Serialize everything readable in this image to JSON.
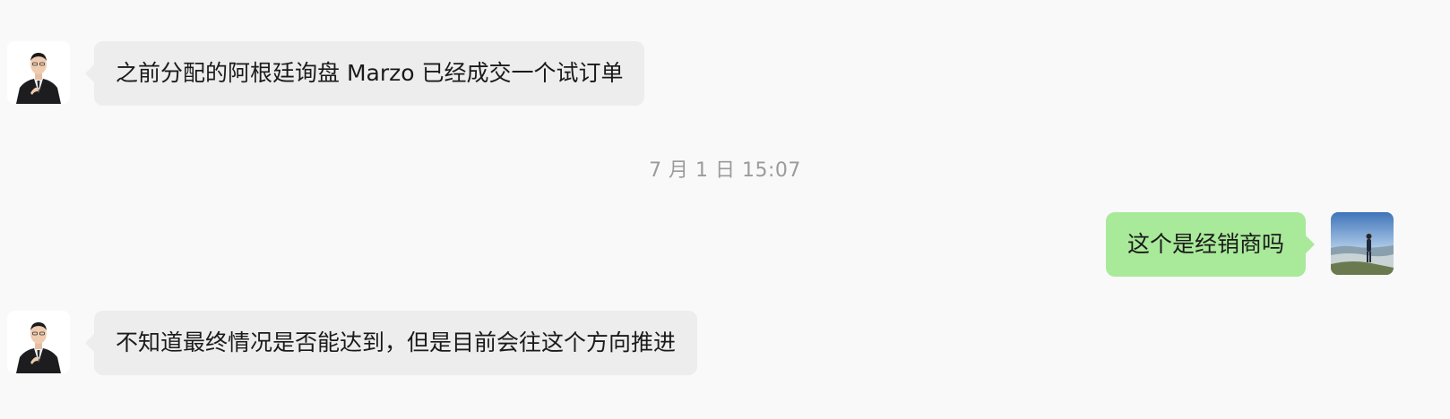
{
  "conversation": {
    "timestamp_top_partial": "·· ··",
    "timestamp_middle": "7 月 1 日 15:07",
    "messages": [
      {
        "direction": "incoming",
        "sender_avatar": "man-in-suit-avatar",
        "text": "之前分配的阿根廷询盘 Marzo 已经成交一个试订单"
      },
      {
        "direction": "outgoing",
        "sender_avatar": "landscape-photo-avatar",
        "text": "这个是经销商吗"
      },
      {
        "direction": "incoming",
        "sender_avatar": "man-in-suit-avatar",
        "text": "不知道最终情况是否能达到，但是目前会往这个方向推进"
      }
    ]
  },
  "colors": {
    "background": "#f9f9f9",
    "incoming_bubble": "#ededee",
    "outgoing_bubble": "#a9e99a",
    "timestamp_text": "#9b9b9b"
  }
}
